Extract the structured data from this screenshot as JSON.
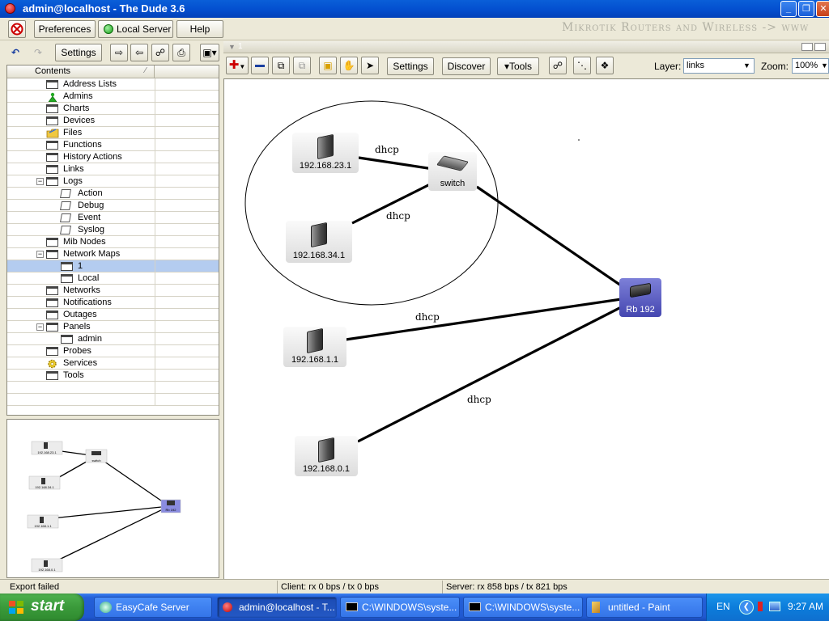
{
  "window": {
    "title": "admin@localhost - The Dude 3.6"
  },
  "menu": {
    "preferences": "Preferences",
    "server": "Local Server",
    "help": "Help",
    "banner": "Mikrotik Routers and Wireless -> www"
  },
  "left_toolbar": {
    "settings": "Settings"
  },
  "map_tab": {
    "name": "1"
  },
  "map_toolbar": {
    "settings": "Settings",
    "discover": "Discover",
    "tools": "▾Tools",
    "layer_label": "Layer:",
    "layer_value": "links",
    "zoom_label": "Zoom:",
    "zoom_value": "100%"
  },
  "tree": {
    "header": "Contents",
    "items": [
      {
        "label": "Address Lists"
      },
      {
        "label": "Admins"
      },
      {
        "label": "Charts"
      },
      {
        "label": "Devices"
      },
      {
        "label": "Files"
      },
      {
        "label": "Functions"
      },
      {
        "label": "History Actions"
      },
      {
        "label": "Links"
      },
      {
        "label": "Logs"
      },
      {
        "label": "Action"
      },
      {
        "label": "Debug"
      },
      {
        "label": "Event"
      },
      {
        "label": "Syslog"
      },
      {
        "label": "Mib Nodes"
      },
      {
        "label": "Network Maps"
      },
      {
        "label": "1"
      },
      {
        "label": "Local"
      },
      {
        "label": "Networks"
      },
      {
        "label": "Notifications"
      },
      {
        "label": "Outages"
      },
      {
        "label": "Panels"
      },
      {
        "label": "admin"
      },
      {
        "label": "Probes"
      },
      {
        "label": "Services"
      },
      {
        "label": "Tools"
      }
    ]
  },
  "map": {
    "nodes": {
      "n23": "192.168.23.1",
      "n34": "192.168.34.1",
      "switch": "switch",
      "rb192": "Rb 192",
      "n1": "192.168.1.1",
      "n0": "192.168.0.1"
    },
    "links": {
      "l1": "dhcp",
      "l2": "dhcp",
      "l3": "dhcp",
      "l4": "dhcp"
    }
  },
  "minimap": {
    "n23": "192.168.23.1",
    "n34": "192.168.34.1",
    "switch": "switch",
    "rb192": "Rb 192",
    "n1": "192.168.1.1",
    "n0": "192.168.0.1"
  },
  "status": {
    "message": "Export failed",
    "client": "Client: rx 0 bps / tx 0 bps",
    "server": "Server: rx 858 bps / tx 821 bps"
  },
  "taskbar": {
    "start": "start",
    "tasks": [
      "EasyCafe Server",
      "admin@localhost - T...",
      "C:\\WINDOWS\\syste...",
      "C:\\WINDOWS\\syste...",
      "untitled - Paint"
    ],
    "lang": "EN",
    "clock": "9:27 AM"
  }
}
